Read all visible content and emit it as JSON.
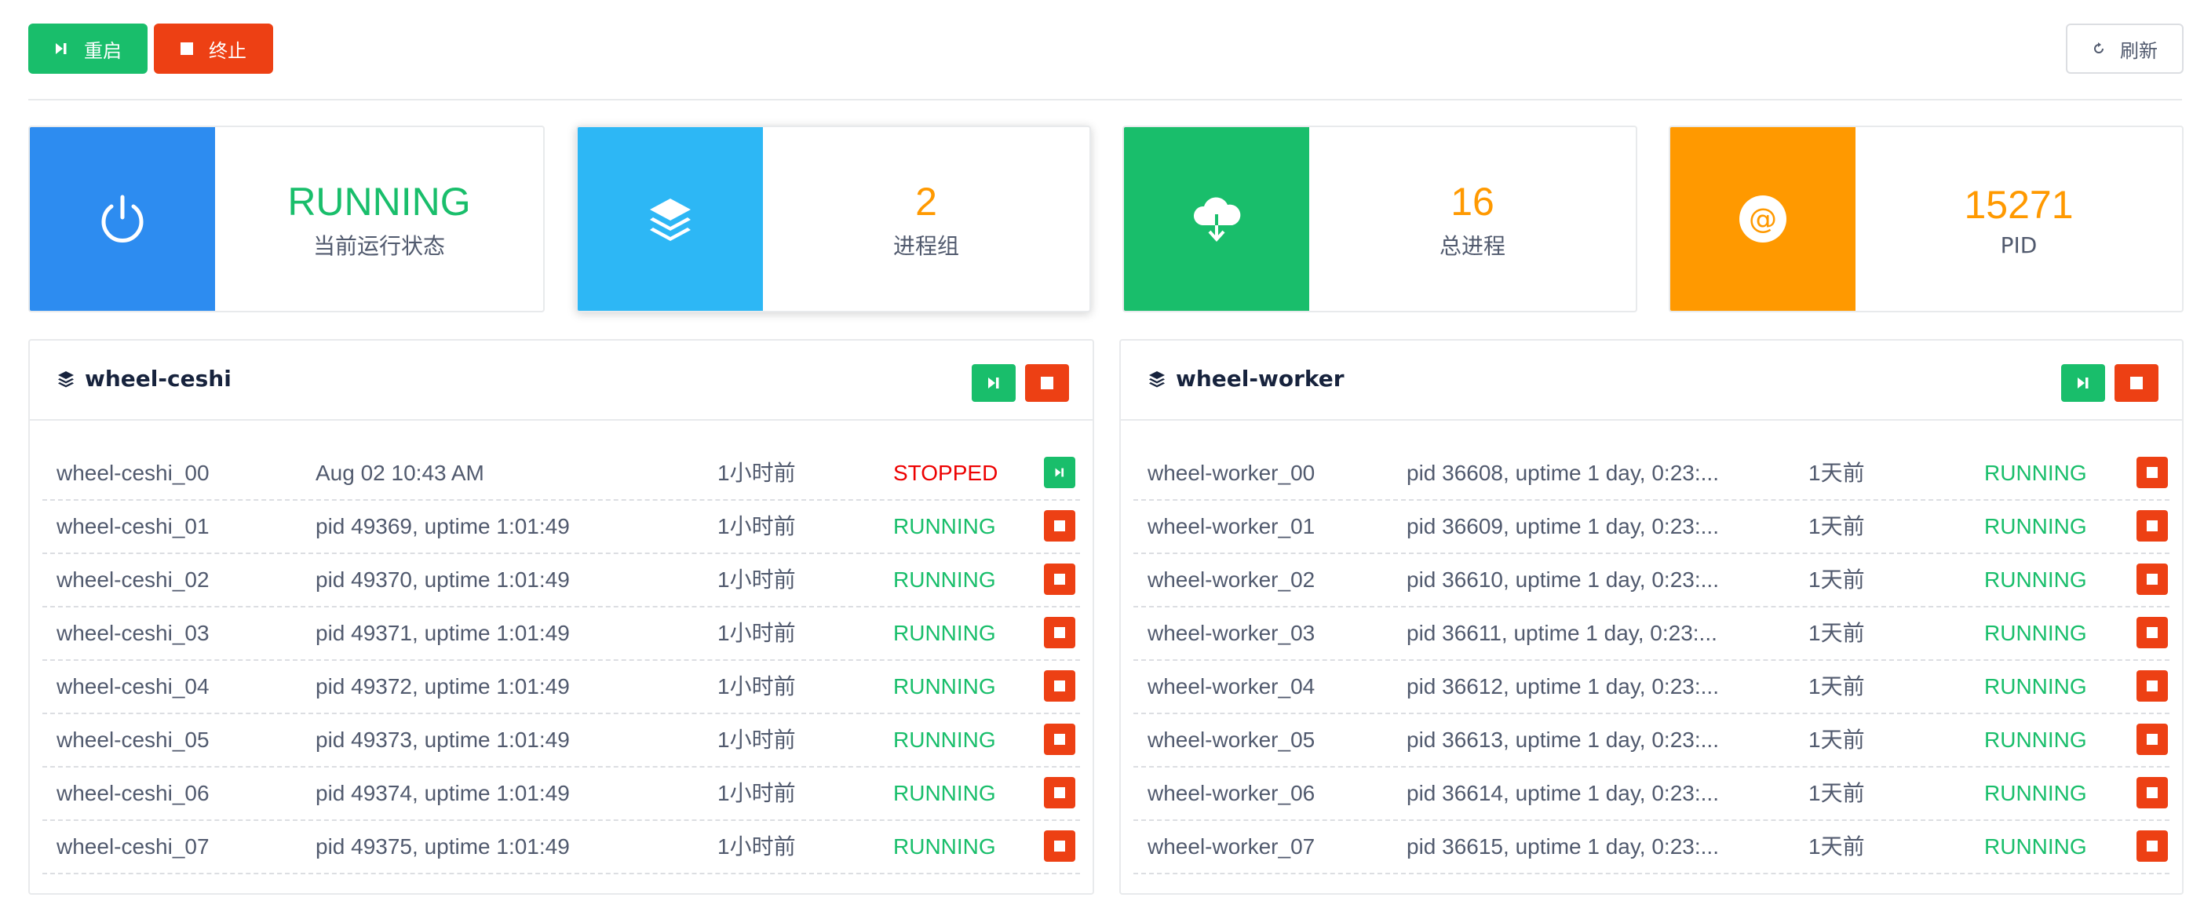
{
  "toolbar": {
    "restart_label": "重启",
    "stop_label": "终止",
    "refresh_label": "刷新"
  },
  "stats": [
    {
      "value": "RUNNING",
      "label": "当前运行状态",
      "icon": "power-icon",
      "color": "#2d8cf0",
      "value_color": "#19be6b"
    },
    {
      "value": "2",
      "label": "进程组",
      "icon": "layers-icon",
      "color": "#2db7f5",
      "value_color": "#ff9900"
    },
    {
      "value": "16",
      "label": "总进程",
      "icon": "cloud-download-icon",
      "color": "#19be6b",
      "value_color": "#ff9900"
    },
    {
      "value": "15271",
      "label": "PID",
      "icon": "at-icon",
      "color": "#ff9900",
      "value_color": "#ff9900"
    }
  ],
  "colors": {
    "running": "#19be6b",
    "stopped": "#ed4014",
    "primary": "#2d8cf0"
  },
  "groups": [
    {
      "title": "wheel-ceshi",
      "processes": [
        {
          "name": "wheel-ceshi_00",
          "desc": "Aug 02 10:43 AM",
          "time": "1小时前",
          "state": "STOPPED"
        },
        {
          "name": "wheel-ceshi_01",
          "desc": "pid 49369, uptime 1:01:49",
          "time": "1小时前",
          "state": "RUNNING"
        },
        {
          "name": "wheel-ceshi_02",
          "desc": "pid 49370, uptime 1:01:49",
          "time": "1小时前",
          "state": "RUNNING"
        },
        {
          "name": "wheel-ceshi_03",
          "desc": "pid 49371, uptime 1:01:49",
          "time": "1小时前",
          "state": "RUNNING"
        },
        {
          "name": "wheel-ceshi_04",
          "desc": "pid 49372, uptime 1:01:49",
          "time": "1小时前",
          "state": "RUNNING"
        },
        {
          "name": "wheel-ceshi_05",
          "desc": "pid 49373, uptime 1:01:49",
          "time": "1小时前",
          "state": "RUNNING"
        },
        {
          "name": "wheel-ceshi_06",
          "desc": "pid 49374, uptime 1:01:49",
          "time": "1小时前",
          "state": "RUNNING"
        },
        {
          "name": "wheel-ceshi_07",
          "desc": "pid 49375, uptime 1:01:49",
          "time": "1小时前",
          "state": "RUNNING"
        }
      ]
    },
    {
      "title": "wheel-worker",
      "processes": [
        {
          "name": "wheel-worker_00",
          "desc": "pid 36608, uptime 1 day, 0:23:...",
          "time": "1天前",
          "state": "RUNNING"
        },
        {
          "name": "wheel-worker_01",
          "desc": "pid 36609, uptime 1 day, 0:23:...",
          "time": "1天前",
          "state": "RUNNING"
        },
        {
          "name": "wheel-worker_02",
          "desc": "pid 36610, uptime 1 day, 0:23:...",
          "time": "1天前",
          "state": "RUNNING"
        },
        {
          "name": "wheel-worker_03",
          "desc": "pid 36611, uptime 1 day, 0:23:...",
          "time": "1天前",
          "state": "RUNNING"
        },
        {
          "name": "wheel-worker_04",
          "desc": "pid 36612, uptime 1 day, 0:23:...",
          "time": "1天前",
          "state": "RUNNING"
        },
        {
          "name": "wheel-worker_05",
          "desc": "pid 36613, uptime 1 day, 0:23:...",
          "time": "1天前",
          "state": "RUNNING"
        },
        {
          "name": "wheel-worker_06",
          "desc": "pid 36614, uptime 1 day, 0:23:...",
          "time": "1天前",
          "state": "RUNNING"
        },
        {
          "name": "wheel-worker_07",
          "desc": "pid 36615, uptime 1 day, 0:23:...",
          "time": "1天前",
          "state": "RUNNING"
        }
      ]
    }
  ]
}
